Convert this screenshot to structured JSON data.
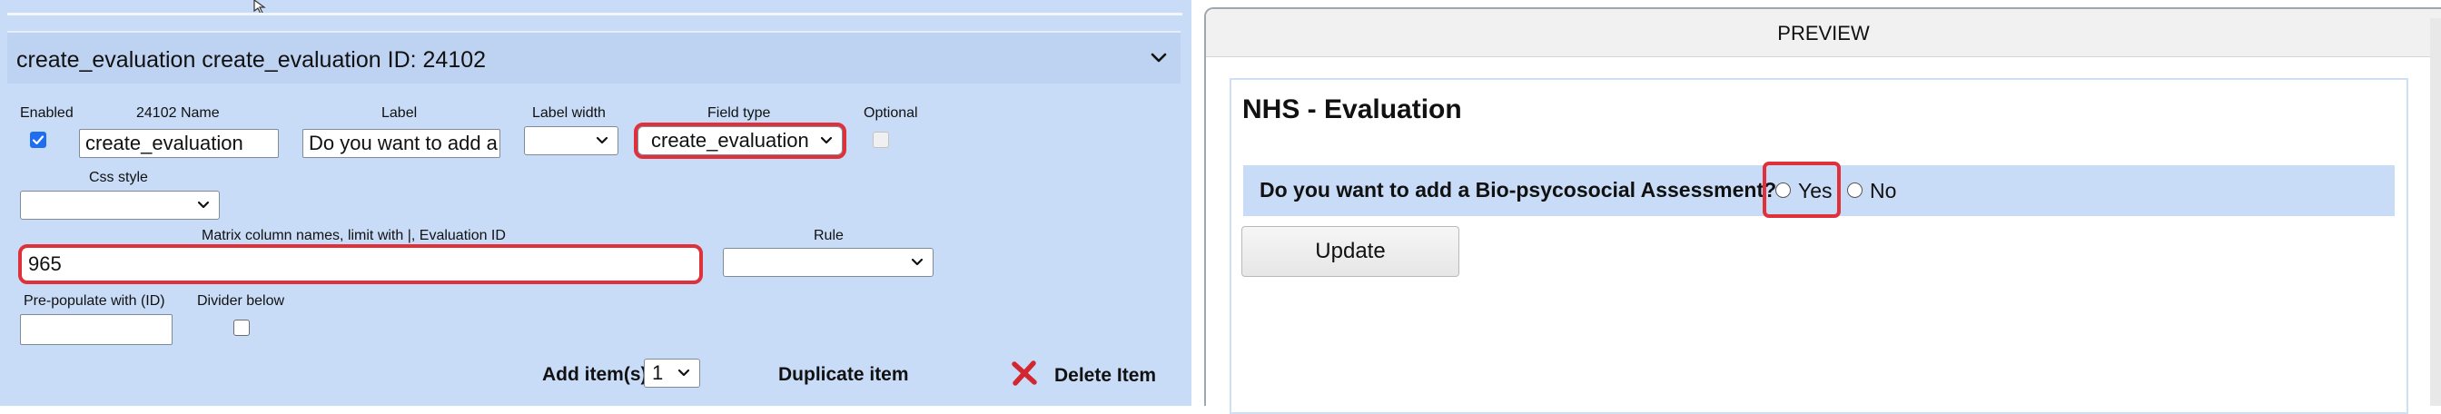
{
  "item": {
    "header_title": "create_evaluation create_evaluation ID: 24102"
  },
  "labels": {
    "enabled": "Enabled",
    "name": "24102 Name",
    "label": "Label",
    "label_width": "Label width",
    "field_type": "Field type",
    "optional": "Optional",
    "css_style": "Css style",
    "matrix": "Matrix column names, limit with |, Evaluation ID",
    "rule": "Rule",
    "prepopulate": "Pre-populate with (ID)",
    "divider": "Divider below"
  },
  "fields": {
    "enabled_checked": true,
    "name_value": "create_evaluation",
    "label_value": "Do you want to add a",
    "label_width_value": "",
    "field_type_value": "create_evaluation",
    "optional_checked": false,
    "css_style_value": "",
    "matrix_value": "965",
    "rule_value": "",
    "prepopulate_value": "",
    "divider_checked": false
  },
  "actions": {
    "add_items_label": "Add item(s)",
    "add_items_value": "1",
    "duplicate_label": "Duplicate item",
    "delete_label": "Delete Item"
  },
  "preview": {
    "header": "PREVIEW",
    "form_title": "NHS - Evaluation",
    "question": "Do you want to add a Bio-psycosocial Assessment?",
    "options": [
      "Yes",
      "No"
    ],
    "update_label": "Update"
  },
  "colors": {
    "panel_bg": "#c9dcf7",
    "highlight": "#e0313b",
    "delete_icon": "#d3272f"
  }
}
